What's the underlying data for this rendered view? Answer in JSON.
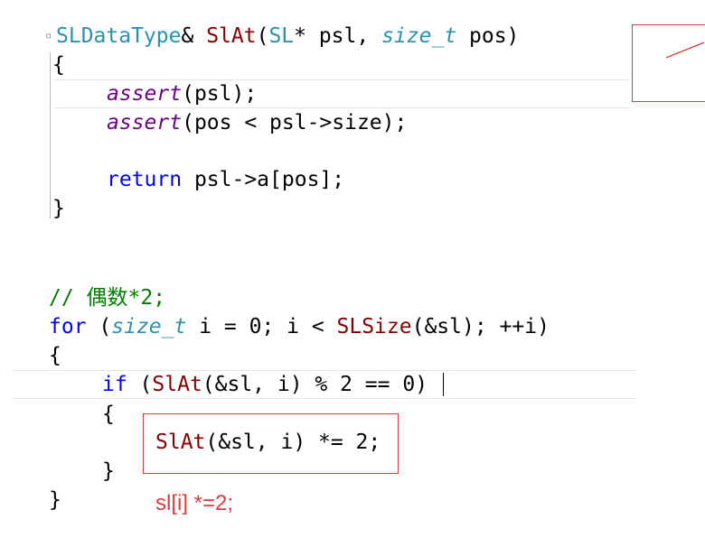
{
  "block1": {
    "sig_type": "SLDataType",
    "sig_amp": "& ",
    "sig_fn": "SlAt",
    "sig_open": "(",
    "sig_type2": "SL",
    "sig_mid": "* psl, ",
    "sig_type3": "size_t",
    "sig_end": " pos)",
    "brace_open": "{",
    "assert_kw": "assert",
    "assert1_args": "(psl);",
    "assert2_args": "(pos < psl->size);",
    "return_kw": "return",
    "return_expr": " psl->a[pos];",
    "brace_close": "}"
  },
  "block2": {
    "comment": "// 偶数*2;",
    "for_kw": "for",
    "for_open": " (",
    "for_type": "size_t",
    "for_mid": " i = 0; i < ",
    "for_fn": "SLSize",
    "for_end": "(&sl); ++i)",
    "brace_open": "{",
    "if_kw": "if",
    "if_open": " (",
    "if_fn": "SlAt",
    "if_end": "(&sl, i) % 2 == 0)",
    "inner_open": "{",
    "stmt_fn": "SlAt",
    "stmt_rest": "(&sl, i) *= 2;",
    "inner_close": "}",
    "brace_close": "}"
  },
  "annotation": {
    "handwritten": "sl[i] *=2;"
  },
  "colors": {
    "annotation_red": "#e0393e",
    "keyword": "#0000ff",
    "type": "#2b91af",
    "macro": "#6f008a",
    "comment": "#008000"
  }
}
